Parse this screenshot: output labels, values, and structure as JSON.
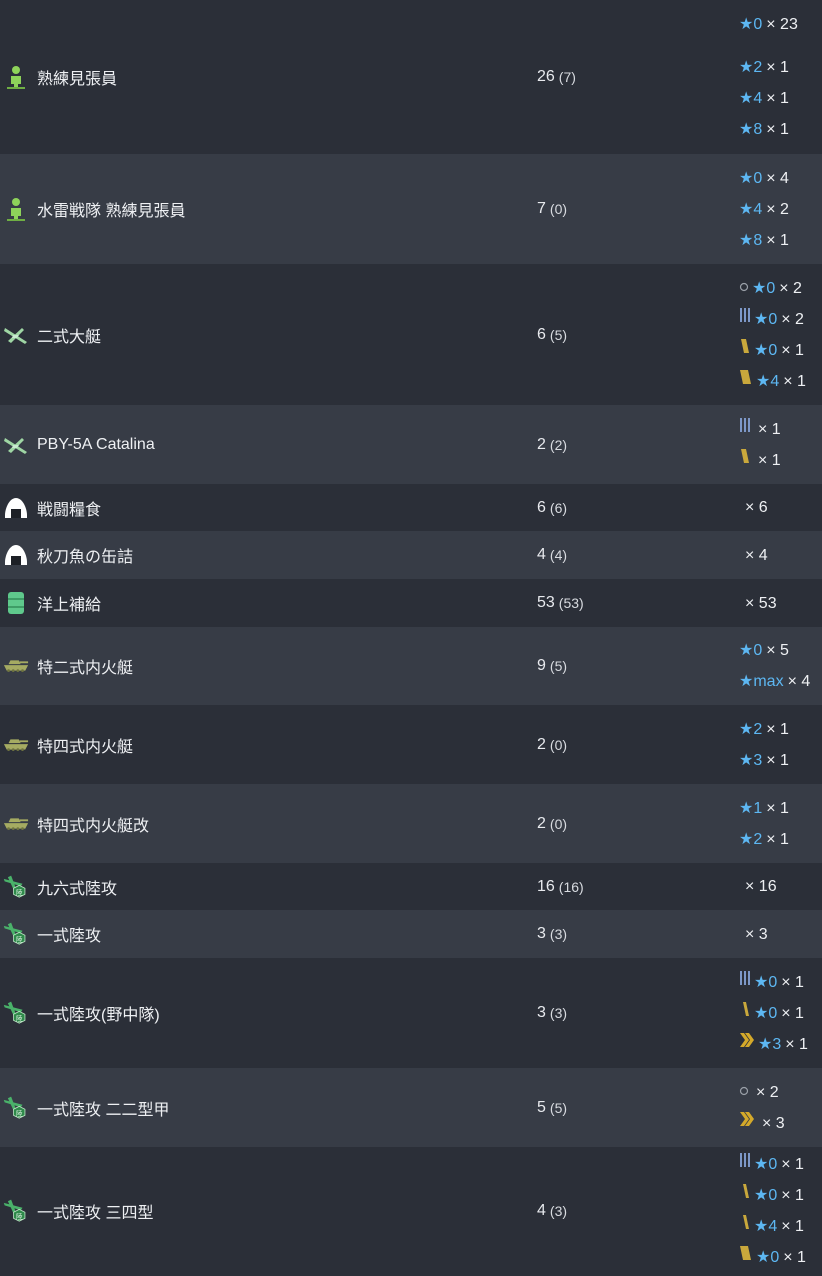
{
  "rows": [
    {
      "icon": "lookout-icon",
      "name": "熟練見張員",
      "count": "26",
      "count_paren": "(7)",
      "height": 154,
      "breakdown": [
        {
          "star": "★0",
          "times": "× 23"
        },
        {
          "gap": true
        },
        {
          "star": "★2",
          "times": "× 1"
        },
        {
          "star": "★4",
          "times": "× 1"
        },
        {
          "star": "★8",
          "times": "× 1"
        }
      ]
    },
    {
      "icon": "lookout-icon",
      "name": "水雷戦隊 熟練見張員",
      "count": "7",
      "count_paren": "(0)",
      "height": 110,
      "breakdown": [
        {
          "star": "★0",
          "times": "× 4"
        },
        {
          "star": "★4",
          "times": "× 2"
        },
        {
          "star": "★8",
          "times": "× 1"
        }
      ]
    },
    {
      "icon": "flying-boat-icon",
      "name": "二式大艇",
      "count": "6",
      "count_paren": "(5)",
      "height": 141,
      "breakdown": [
        {
          "prof": "circle",
          "star": "★0",
          "times": "× 2"
        },
        {
          "prof": "bars-blue",
          "star": "★0",
          "times": "× 2"
        },
        {
          "prof": "bar-gold",
          "star": "★0",
          "times": "× 1"
        },
        {
          "prof": "bar-gold-wide",
          "star": "★4",
          "times": "× 1"
        }
      ]
    },
    {
      "icon": "flying-boat-icon",
      "name": "PBY-5A Catalina",
      "count": "2",
      "count_paren": "(2)",
      "height": 79,
      "breakdown": [
        {
          "prof": "bars-blue",
          "star": "",
          "times": "× 1"
        },
        {
          "prof": "bar-gold",
          "star": "",
          "times": "× 1"
        }
      ]
    },
    {
      "icon": "ration-icon",
      "name": "戦闘糧食",
      "count": "6",
      "count_paren": "(6)",
      "height": 47,
      "breakdown": [
        {
          "star": "",
          "times": "× 6"
        }
      ]
    },
    {
      "icon": "ration-icon",
      "name": "秋刀魚の缶詰",
      "count": "4",
      "count_paren": "(4)",
      "height": 48,
      "breakdown": [
        {
          "star": "",
          "times": "× 4"
        }
      ]
    },
    {
      "icon": "drum-icon",
      "name": "洋上補給",
      "count": "53",
      "count_paren": "(53)",
      "height": 48,
      "breakdown": [
        {
          "star": "",
          "times": "× 53"
        }
      ]
    },
    {
      "icon": "tank-icon",
      "name": "特二式内火艇",
      "count": "9",
      "count_paren": "(5)",
      "height": 78,
      "breakdown": [
        {
          "star": "★0",
          "times": "× 5"
        },
        {
          "star": "★max",
          "times": "× 4"
        }
      ]
    },
    {
      "icon": "tank-icon",
      "name": "特四式内火艇",
      "count": "2",
      "count_paren": "(0)",
      "height": 79,
      "breakdown": [
        {
          "star": "★2",
          "times": "× 1"
        },
        {
          "star": "★3",
          "times": "× 1"
        }
      ]
    },
    {
      "icon": "tank-icon",
      "name": "特四式内火艇改",
      "count": "2",
      "count_paren": "(0)",
      "height": 79,
      "breakdown": [
        {
          "star": "★1",
          "times": "× 1"
        },
        {
          "star": "★2",
          "times": "× 1"
        }
      ]
    },
    {
      "icon": "land-bomber-icon",
      "name": "九六式陸攻",
      "count": "16",
      "count_paren": "(16)",
      "height": 47,
      "breakdown": [
        {
          "star": "",
          "times": "× 16"
        }
      ]
    },
    {
      "icon": "land-bomber-icon",
      "name": "一式陸攻",
      "count": "3",
      "count_paren": "(3)",
      "height": 48,
      "breakdown": [
        {
          "star": "",
          "times": "× 3"
        }
      ]
    },
    {
      "icon": "land-bomber-icon",
      "name": "一式陸攻(野中隊)",
      "count": "3",
      "count_paren": "(3)",
      "height": 110,
      "breakdown": [
        {
          "prof": "bars-blue",
          "star": "★0",
          "times": "× 1"
        },
        {
          "prof": "bar-gold-thin",
          "star": "★0",
          "times": "× 1"
        },
        {
          "prof": "chevron-gold",
          "star": "★3",
          "times": "× 1"
        }
      ]
    },
    {
      "icon": "land-bomber-icon",
      "name": "一式陸攻 二二型甲",
      "count": "5",
      "count_paren": "(5)",
      "height": 79,
      "breakdown": [
        {
          "prof": "circle",
          "star": "",
          "times": "× 2"
        },
        {
          "prof": "chevron-gold",
          "star": "",
          "times": "× 3"
        }
      ]
    },
    {
      "icon": "land-bomber-icon",
      "name": "一式陸攻 三四型",
      "count": "4",
      "count_paren": "(3)",
      "height": 128,
      "breakdown": [
        {
          "prof": "bars-blue",
          "star": "★0",
          "times": "× 1"
        },
        {
          "prof": "bar-gold-thin",
          "star": "★0",
          "times": "× 1"
        },
        {
          "prof": "bar-gold-thin",
          "star": "★4",
          "times": "× 1"
        },
        {
          "prof": "bar-gold-wide",
          "star": "★0",
          "times": "× 1"
        }
      ]
    }
  ]
}
